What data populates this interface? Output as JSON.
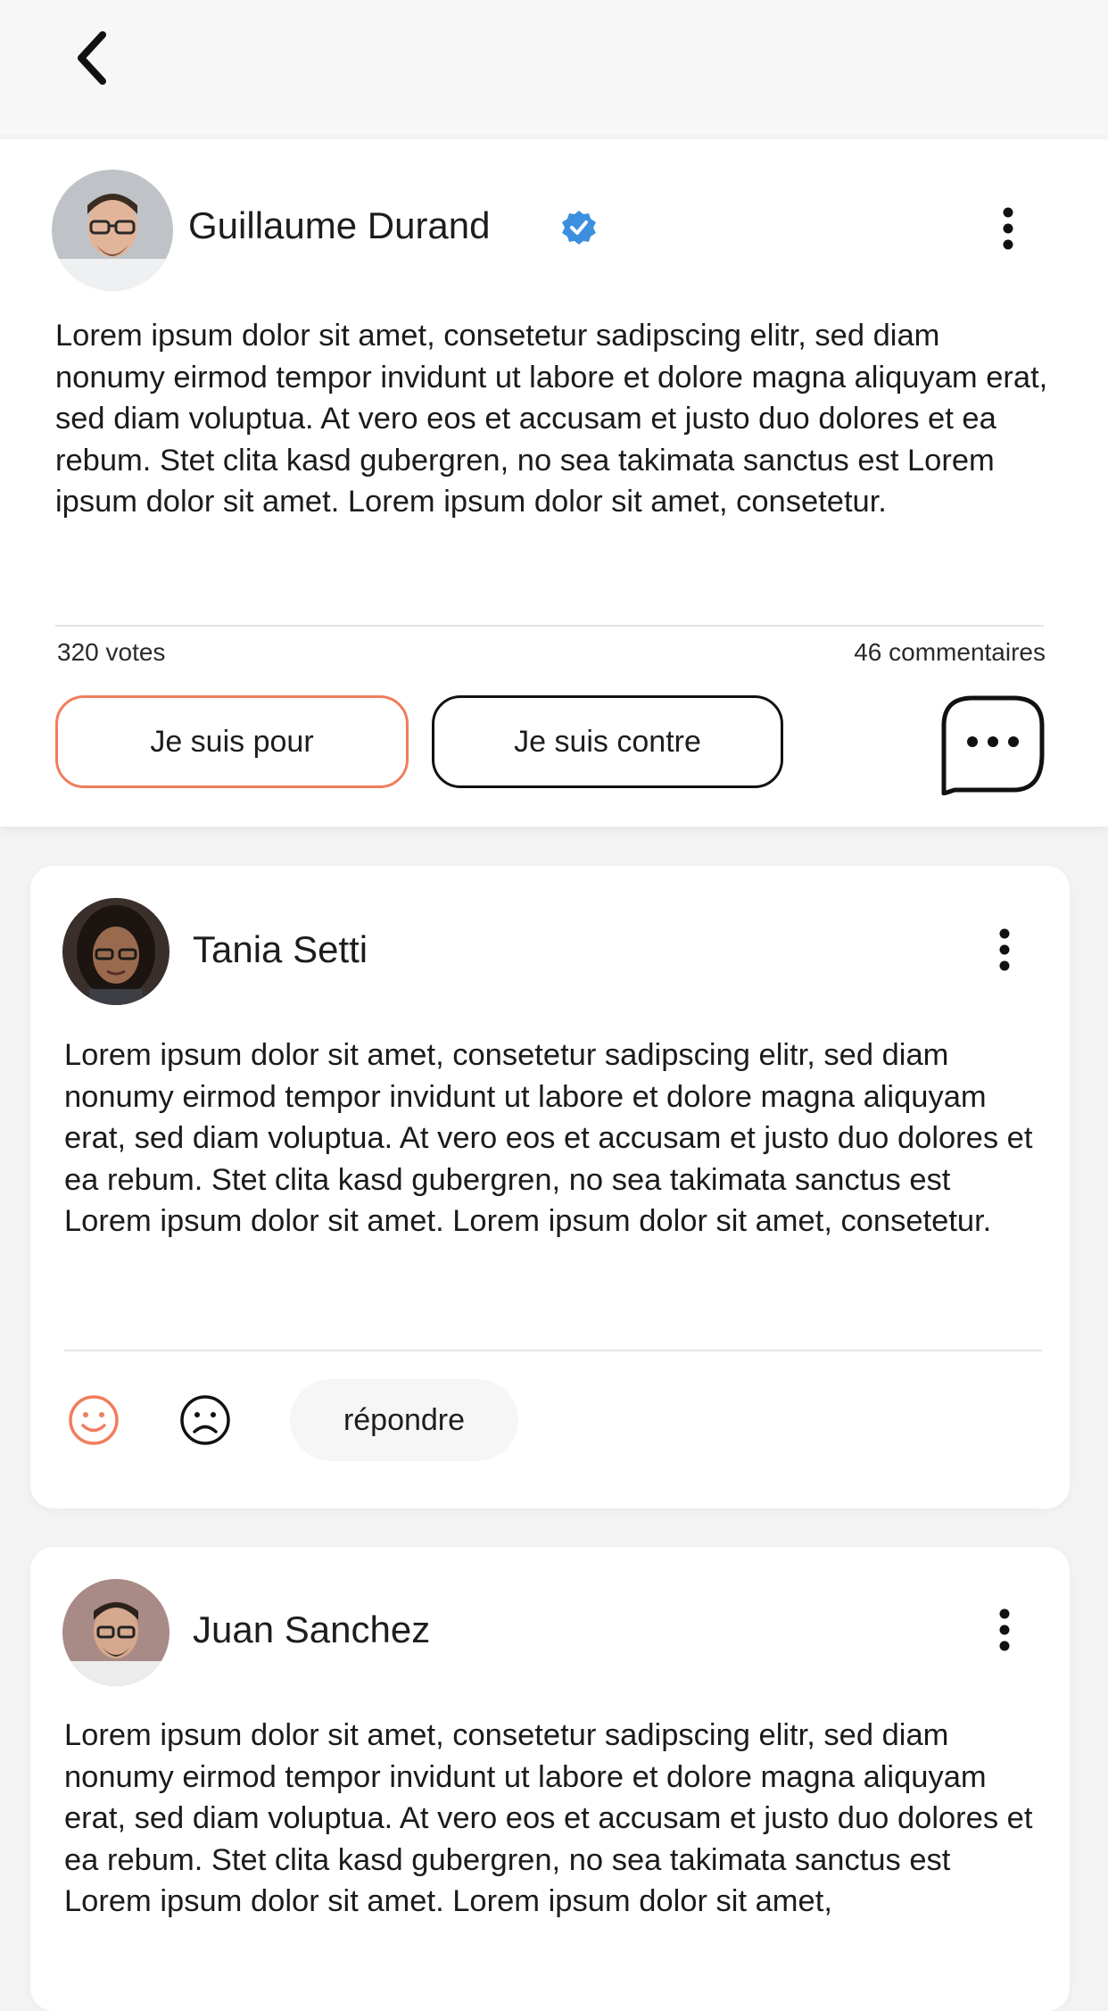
{
  "header": {
    "back_icon": "chevron-left-icon"
  },
  "post": {
    "author": "Guillaume Durand",
    "verified_icon": "verified-badge-icon",
    "body": "Lorem ipsum dolor sit amet, consetetur sadipscing elitr, sed diam nonumy eirmod tempor invidunt ut labore et dolore magna aliquyam erat, sed diam voluptua. At vero eos et accusam et justo duo dolores et ea rebum. Stet clita kasd gubergren, no sea takimata sanctus est Lorem ipsum dolor sit amet. Lorem ipsum dolor sit amet, consetetur.",
    "votes": "320 votes",
    "comments": "46 commentaires",
    "for_label": "Je suis pour",
    "against_label": "Je suis contre"
  },
  "comments": [
    {
      "author": "Tania Setti",
      "body": "Lorem ipsum dolor sit amet, consetetur sadipscing elitr, sed diam nonumy eirmod tempor invidunt ut labore et dolore magna aliquyam erat, sed diam voluptua. At vero eos et accusam et justo duo dolores et ea rebum. Stet clita kasd gubergren, no sea takimata sanctus est Lorem ipsum dolor sit amet. Lorem ipsum dolor sit amet, consetetur.",
      "reply_label": "répondre"
    },
    {
      "author": "Juan Sanchez",
      "body": "Lorem ipsum dolor sit amet, consetetur sadipscing elitr, sed diam nonumy eirmod tempor invidunt ut labore et dolore magna aliquyam erat, sed diam voluptua. At vero eos et accusam et justo duo dolores et ea rebum. Stet clita kasd gubergren, no sea takimata sanctus est Lorem ipsum dolor sit amet. Lorem ipsum dolor sit amet,"
    }
  ],
  "colors": {
    "accent": "#f07d5c",
    "verified": "#3d8fe0"
  }
}
